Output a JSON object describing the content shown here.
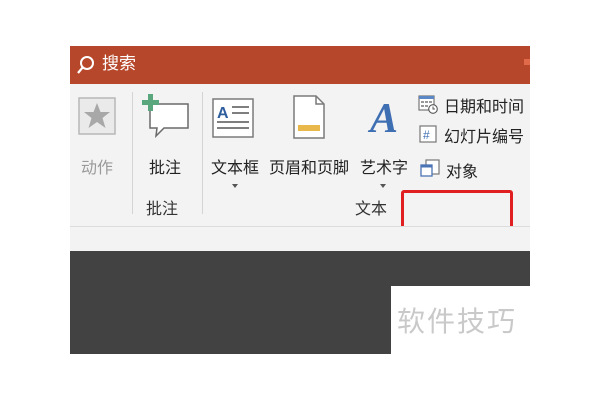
{
  "titlebar": {
    "search_label": "搜索"
  },
  "ribbon": {
    "action_label": "动作",
    "comment_label": "批注",
    "comment_group_label": "批注",
    "textbox_label": "文本框",
    "header_footer_label": "页眉和页脚",
    "wordart_label": "艺术字",
    "datetime_label": "日期和时间",
    "slide_number_label": "幻灯片编号",
    "object_label": "对象",
    "text_group_label": "文本"
  },
  "watermark": "软件技巧",
  "colors": {
    "title_bar": "#b7472a",
    "highlight": "#e02020",
    "dark_area": "#424242"
  }
}
